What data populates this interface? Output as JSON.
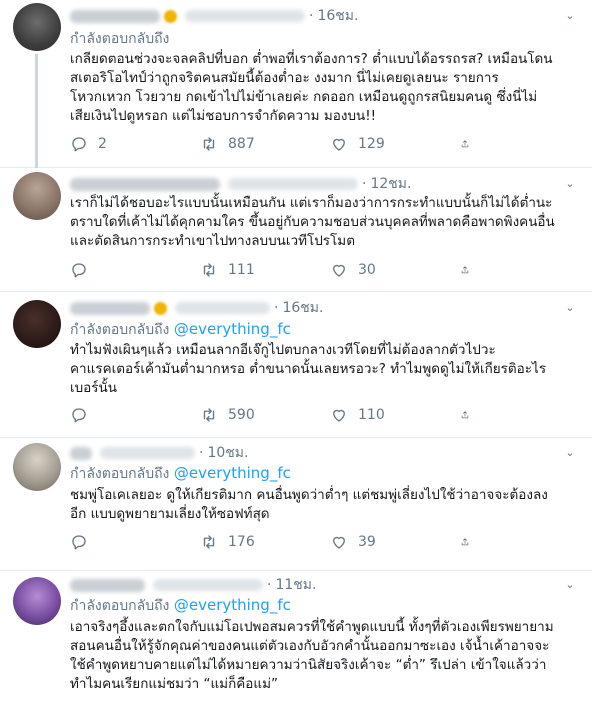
{
  "tweets": [
    {
      "time": "16ชม.",
      "reply_label": "กำลังตอบกลับถึง",
      "mention": "",
      "lines": [
        "เกลียดตอนช่วงจะจลคลิปที่บอก ต่ำพอที่เราต้องการ? ต่ำแบบได้อรรถรส? เหมือนโดน",
        "สเตอริโอไทป์ว่าถูกจริตคนสมัยนี้ต้องต่ำอะ งงมาก นี่ไม่เคยดูเลยนะ รายการ",
        "โหวกเหวก โวยวาย กดเข้าไปไม่ข้าเลยค่ะ กดออก เหมือนดูถูกรสนิยมคนดู ซึ่งนี่ไม่",
        "เสียเงินไปดูหรอก แต่ไม่ชอบการจำกัดความ มองบน!!"
      ],
      "replies": "2",
      "retweets": "887",
      "likes": "129"
    },
    {
      "time": "12ชม.",
      "reply_label": "",
      "mention": "",
      "lines": [
        "เราก็ไม่ได้ชอบอะไรแบบนั้นเหมือนกัน แต่เราก็มองว่าการกระทำแบบนั้นก็ไม่ได้ต่ำนะ",
        "ตราบใดที่เค้าไม่ได้คุกคามใคร ขึ้นอยู่กับความชอบส่วนบุคคลที่พลาดคือพาดพิงคนอื่น",
        "และตัดสินการกระทำเขาไปทางลบบนเวทีโปรโมต"
      ],
      "replies": "",
      "retweets": "111",
      "likes": "30"
    },
    {
      "time": "16ชม.",
      "reply_label": "กำลังตอบกลับถึง",
      "mention": "@everything_fc",
      "lines": [
        "ทำไมฟังเผินๆแล้ว เหมือนลากอีเจ๊กูไปตบกลางเวทีโดยที่ไม่ต้องลากตัวไปวะ",
        "คาแรคเตอร์เค้ามันต่ำมากหรอ ต่ำขนาดนั้นเลยหรอวะ? ทำไมพูดดูไม่ให้เกียรติอะไร",
        "เบอร์นั้น"
      ],
      "replies": "",
      "retweets": "590",
      "likes": "110"
    },
    {
      "time": "10ชม.",
      "reply_label": "กำลังตอบกลับถึง",
      "mention": "@everything_fc",
      "lines": [
        "ชมพู่โอเคเลยอะ ดูให้เกียรติมาก คนอื่นพูดว่าต่ำๆ แต่ชมพู่เลี่ยงไปใช้ว่าอาจจะต้องลง",
        "อีก แบบดูพยายามเลี่ยงให้ซอฟท์สุด"
      ],
      "replies": "",
      "retweets": "176",
      "likes": "39"
    },
    {
      "time": "11ชม.",
      "reply_label": "กำลังตอบกลับถึง",
      "mention": "@everything_fc",
      "lines": [
        "เอาจริงๆอึ้งและตกใจกับแม่โอเปพอสมควรที่ใช้คำพูดแบบนี้ ทั้งๆที่ตัวเองเพียรพยายาม",
        "สอนคนอื่นให้รู้จักคุณค่าของคนแต่ตัวเองกับอัวกคำนั้นออกมาซะเอง เจ้น้ำเค้าอาจจะ",
        "ใช้คำพูดหยาบคายแต่ไม่ได้หมายความว่านิสัยจริงเค้าจะ “ต่ำ” รึเปล่า เข้าใจแล้วว่า",
        "ทำไมคนเรียกแม่ชมว่า “แม่ก็คือแม่”"
      ],
      "replies": "",
      "retweets": "",
      "likes": ""
    }
  ],
  "colors": {
    "link": "#1da1f2",
    "muted": "#657786",
    "divider": "#e6ecf0",
    "thread_line": "#ccd6dd"
  },
  "icons": [
    "reply-icon",
    "retweet-icon",
    "like-icon",
    "share-icon",
    "chevron-down-icon"
  ]
}
